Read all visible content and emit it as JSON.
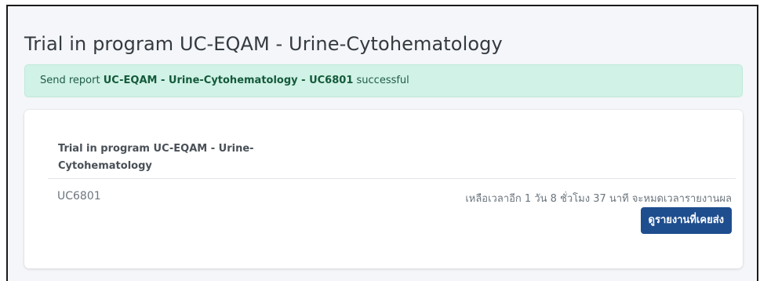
{
  "page": {
    "title": "Trial in program UC-EQAM - Urine-Cytohematology"
  },
  "alert": {
    "prefix": "Send report ",
    "report_name": "UC-EQAM - Urine-Cytohematology - UC6801",
    "suffix": " successful"
  },
  "card": {
    "title": "Trial in program UC-EQAM - Urine-Cytohematology",
    "program_code": "UC6801",
    "time_remaining": "เหลือเวลาอีก 1 วัน 8 ชั่วโมง 37 นาที จะหมดเวลารายงานผล",
    "view_button_label": "ดูรายงานที่เคยส่ง"
  }
}
